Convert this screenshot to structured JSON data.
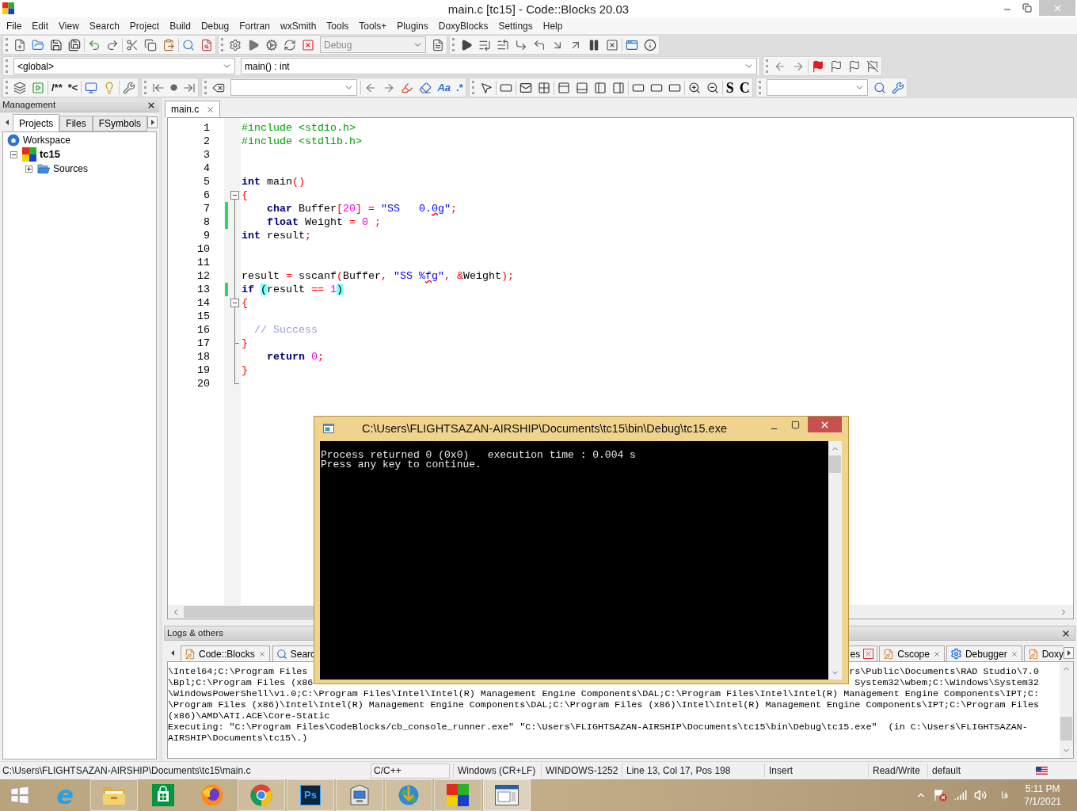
{
  "window": {
    "title": "main.c [tc15] - Code::Blocks 20.03"
  },
  "menu": [
    "File",
    "Edit",
    "View",
    "Search",
    "Project",
    "Build",
    "Debug",
    "Fortran",
    "wxSmith",
    "Tools",
    "Tools+",
    "Plugins",
    "DoxyBlocks",
    "Settings",
    "Help"
  ],
  "toolbars": {
    "build_target": "Debug",
    "scope": "<global>",
    "function": "main() : int",
    "comment_buttons": [
      "/**",
      "*<"
    ],
    "search_toggles": [
      "Aa",
      ".*"
    ],
    "style_buttons": [
      "S",
      "C"
    ]
  },
  "management": {
    "title": "Management",
    "tabs": [
      {
        "label": "Projects",
        "selected": true
      },
      {
        "label": "Files",
        "selected": false
      },
      {
        "label": "FSymbols",
        "selected": false
      }
    ],
    "tree": [
      {
        "label": "Workspace",
        "kind": "workspace",
        "children": [
          {
            "label": "tc15",
            "kind": "project",
            "expanded": true,
            "children": [
              {
                "label": "Sources",
                "kind": "folder",
                "expanded": false
              }
            ]
          }
        ]
      }
    ]
  },
  "editor": {
    "tabs": [
      {
        "label": "main.c",
        "selected": true
      }
    ],
    "lines": [
      {
        "number": "1",
        "changed": false,
        "fold_start": false,
        "fold_end": false,
        "tokens": [
          {
            "kind": "preprocessor",
            "text": "#include <stdio.h>"
          }
        ]
      },
      {
        "number": "2",
        "changed": false,
        "fold_start": false,
        "fold_end": false,
        "tokens": [
          {
            "kind": "preprocessor",
            "text": "#include <stdlib.h>"
          }
        ]
      },
      {
        "number": "3",
        "changed": false,
        "fold_start": false,
        "fold_end": false
      },
      {
        "number": "4",
        "changed": false,
        "fold_start": false,
        "fold_end": false
      },
      {
        "number": "5",
        "changed": false,
        "fold_start": false,
        "fold_end": false,
        "tokens": [
          {
            "kind": "keyword",
            "text": "int"
          },
          {
            "kind": "plain",
            "text": " main"
          },
          {
            "kind": "operator",
            "text": "()"
          }
        ]
      },
      {
        "number": "6",
        "changed": false,
        "fold_start": true,
        "fold_end": false,
        "tokens": [
          {
            "kind": "operator",
            "text": "{"
          }
        ]
      },
      {
        "number": "7",
        "changed": true,
        "fold_start": false,
        "fold_end": false,
        "tokens": [
          {
            "kind": "keyword",
            "text": "    char"
          },
          {
            "kind": "plain",
            "text": " Buffer"
          },
          {
            "kind": "operator",
            "text": "["
          },
          {
            "kind": "number",
            "text": "20"
          },
          {
            "kind": "operator",
            "text": "] = "
          },
          {
            "kind": "string",
            "text": "\"SS   0."
          },
          {
            "kind": "misspelled",
            "text": "0g"
          },
          {
            "kind": "string",
            "text": "\""
          },
          {
            "kind": "operator",
            "text": ";"
          }
        ]
      },
      {
        "number": "8",
        "changed": true,
        "fold_start": false,
        "fold_end": false,
        "tokens": [
          {
            "kind": "keyword",
            "text": "    float"
          },
          {
            "kind": "plain",
            "text": " Weight "
          },
          {
            "kind": "operator",
            "text": "= "
          },
          {
            "kind": "number",
            "text": "0"
          },
          {
            "kind": "operator",
            "text": " ;"
          }
        ]
      },
      {
        "number": "9",
        "changed": false,
        "fold_start": false,
        "fold_end": false,
        "tokens": [
          {
            "kind": "keyword",
            "text": "int"
          },
          {
            "kind": "plain",
            "text": " result"
          },
          {
            "kind": "operator",
            "text": ";"
          }
        ]
      },
      {
        "number": "10",
        "changed": false,
        "fold_start": false,
        "fold_end": false
      },
      {
        "number": "11",
        "changed": false,
        "fold_start": false,
        "fold_end": false
      },
      {
        "number": "12",
        "changed": false,
        "fold_start": false,
        "fold_end": false,
        "tokens": [
          {
            "kind": "plain",
            "text": "result "
          },
          {
            "kind": "operator",
            "text": "="
          },
          {
            "kind": "plain",
            "text": " sscanf"
          },
          {
            "kind": "operator",
            "text": "("
          },
          {
            "kind": "plain",
            "text": "Buffer"
          },
          {
            "kind": "operator",
            "text": ", "
          },
          {
            "kind": "string",
            "text": "\"SS %"
          },
          {
            "kind": "misspelled",
            "text": "fg"
          },
          {
            "kind": "string",
            "text": "\""
          },
          {
            "kind": "operator",
            "text": ", &"
          },
          {
            "kind": "plain",
            "text": "Weight"
          },
          {
            "kind": "operator",
            "text": ");"
          }
        ]
      },
      {
        "number": "13",
        "changed": true,
        "fold_start": false,
        "fold_end": false,
        "tokens": [
          {
            "kind": "keyword",
            "text": "if "
          },
          {
            "kind": "brace_match",
            "text": "("
          },
          {
            "kind": "plain",
            "text": "result "
          },
          {
            "kind": "operator",
            "text": "== "
          },
          {
            "kind": "number",
            "text": "1"
          },
          {
            "kind": "brace_match",
            "text": ")"
          }
        ]
      },
      {
        "number": "14",
        "changed": false,
        "fold_start": true,
        "fold_end": false,
        "tokens": [
          {
            "kind": "operator",
            "text": "{"
          }
        ]
      },
      {
        "number": "15",
        "changed": false,
        "fold_start": false,
        "fold_end": false
      },
      {
        "number": "16",
        "changed": false,
        "fold_start": false,
        "fold_end": false,
        "tokens": [
          {
            "kind": "comment",
            "text": "  // Success"
          }
        ]
      },
      {
        "number": "17",
        "changed": false,
        "fold_start": false,
        "fold_end": true,
        "tokens": [
          {
            "kind": "operator",
            "text": "}"
          }
        ]
      },
      {
        "number": "18",
        "changed": false,
        "fold_start": false,
        "fold_end": false,
        "tokens": [
          {
            "kind": "keyword",
            "text": "    return "
          },
          {
            "kind": "number",
            "text": "0"
          },
          {
            "kind": "operator",
            "text": ";"
          }
        ]
      },
      {
        "number": "19",
        "changed": false,
        "fold_start": false,
        "fold_end": false,
        "tokens": [
          {
            "kind": "operator",
            "text": "}"
          }
        ]
      },
      {
        "number": "20",
        "changed": false,
        "fold_start": false,
        "fold_end": true
      }
    ]
  },
  "logs": {
    "title": "Logs & others",
    "tabs_left": [
      {
        "label": "Code::Blocks",
        "kind": "pencil",
        "selected": false,
        "truncated": false
      },
      {
        "label": "Searc",
        "kind": "magnifier",
        "selected": false,
        "truncated": true
      }
    ],
    "tabs_right": [
      {
        "label": "es",
        "kind": "boxed-close",
        "selected": false,
        "truncated": false
      },
      {
        "label": "Cscope",
        "kind": "pencil",
        "selected": false,
        "truncated": false
      },
      {
        "label": "Debugger",
        "kind": "gear",
        "selected": false,
        "truncated": false
      },
      {
        "label": "Doxy",
        "kind": "pencil",
        "selected": false,
        "truncated": true
      }
    ],
    "lines": [
      {
        "left": "\\Intel64;C:\\Program Files",
        "right": "rs\\Public\\Documents\\RAD Studio\\7.0"
      },
      {
        "left": "\\Bpl;C:\\Program Files (x86",
        "right": "System32\\wbem;C:\\Windows\\System32"
      },
      {
        "text": "\\WindowsPowerShell\\v1.0;C:\\Program Files\\Intel\\Intel(R) Management Engine Components\\DAL;C:\\Program Files\\Intel\\Intel(R) Management Engine Components\\IPT;C:"
      },
      {
        "text": "\\Program Files (x86)\\Intel\\Intel(R) Management Engine Components\\DAL;C:\\Program Files (x86)\\Intel\\Intel(R) Management Engine Components\\IPT;C:\\Program Files"
      },
      {
        "text": "(x86)\\AMD\\ATI.ACE\\Core-Static"
      },
      {
        "text": "Executing: \"C:\\Program Files\\CodeBlocks/cb_console_runner.exe\" \"C:\\Users\\FLIGHTSAZAN-AIRSHIP\\Documents\\tc15\\bin\\Debug\\tc15.exe\"  (in C:\\Users\\FLIGHTSAZAN-"
      },
      {
        "text": "AIRSHIP\\Documents\\tc15\\.)"
      }
    ]
  },
  "console": {
    "title": "C:\\Users\\FLIGHTSAZAN-AIRSHIP\\Documents\\tc15\\bin\\Debug\\tc15.exe",
    "lines": [
      "Process returned 0 (0x0)   execution time : 0.004 s",
      "Press any key to continue."
    ]
  },
  "status_bar": {
    "file": "C:\\Users\\FLIGHTSAZAN-AIRSHIP\\Documents\\tc15\\main.c",
    "language": "C/C++",
    "line_endings": "Windows (CR+LF)",
    "encoding": "WINDOWS-1252",
    "position": "Line 13, Col 17, Pos 198",
    "mode": "Insert",
    "access": "Read/Write",
    "profile": "default"
  },
  "taskbar": {
    "apps": [
      {
        "kind": "e-logo",
        "glyph": "e",
        "running": false,
        "selected": false
      },
      {
        "kind": "folder",
        "running": true,
        "selected": false
      },
      {
        "kind": "bag",
        "running": false,
        "selected": false
      },
      {
        "kind": "fox",
        "running": false,
        "selected": false
      },
      {
        "kind": "tricolor",
        "running": true,
        "selected": false
      },
      {
        "kind": "ps-logo",
        "glyph": "Ps",
        "running": true,
        "selected": false
      },
      {
        "kind": "box",
        "running": true,
        "selected": false
      },
      {
        "kind": "globe",
        "running": true,
        "selected": false
      },
      {
        "kind": "squares",
        "running": true,
        "selected": false
      },
      {
        "kind": "console",
        "running": true,
        "selected": true
      }
    ],
    "input_language": "فا",
    "time": "5:11 PM",
    "date": "7/1/2021"
  }
}
